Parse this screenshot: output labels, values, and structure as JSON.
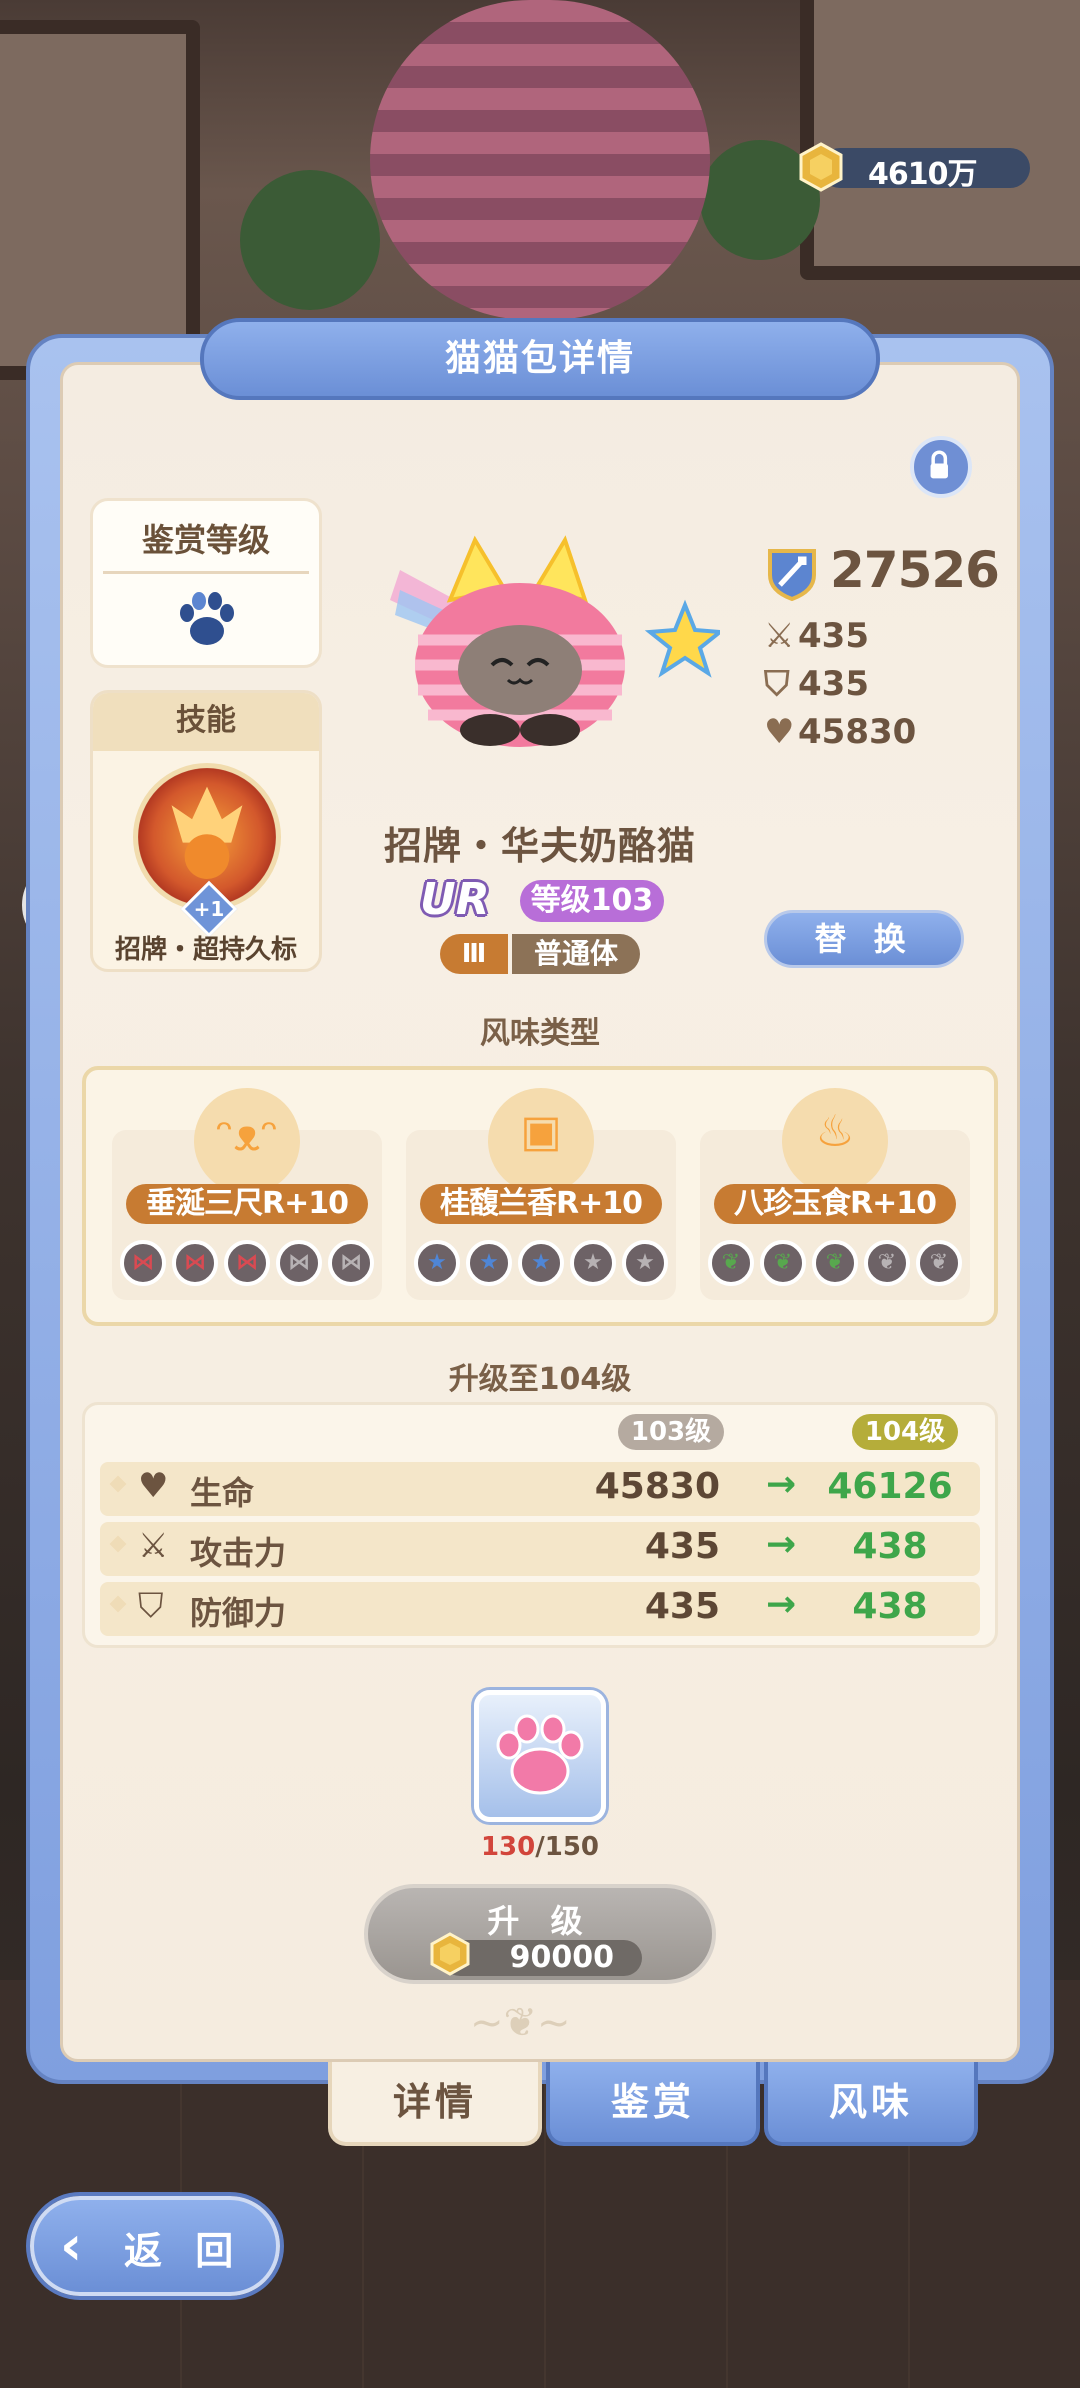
{
  "currency": {
    "amount": "4610万",
    "icon": "gold-coin-icon"
  },
  "panel_title": "猫猫包详情",
  "appraisal": {
    "title": "鉴赏等级",
    "icon": "paw-icon"
  },
  "skill": {
    "title": "技能",
    "badge": "+1",
    "name": "招牌・超持久标"
  },
  "cat": {
    "name": "招牌・华夫奶酪猫",
    "rarity": "UR",
    "level": "等级103",
    "rank": "Ⅲ",
    "body_type": "普通体"
  },
  "stats": {
    "power": "27526",
    "attack": "435",
    "defense": "435",
    "hp": "45830"
  },
  "replace_label": "替 换",
  "flavor": {
    "title": "风味类型",
    "items": [
      {
        "label": "垂涎三尺R+10",
        "icon": "cat-face-icon",
        "filled": 3,
        "total": 5,
        "color": "#d94a52",
        "glyph": "⋈"
      },
      {
        "label": "桂馥兰香R+10",
        "icon": "cube-face-icon",
        "filled": 3,
        "total": 5,
        "color": "#4f86d6",
        "glyph": "★"
      },
      {
        "label": "八珍玉食R+10",
        "icon": "flame-icon",
        "filled": 3,
        "total": 5,
        "color": "#58a84e",
        "glyph": "❦"
      }
    ]
  },
  "upgrade": {
    "title": "升级至104级",
    "current_level": "103级",
    "next_level": "104级",
    "rows": [
      {
        "label": "生命",
        "icon": "heart-icon",
        "current": "45830",
        "next": "46126"
      },
      {
        "label": "攻击力",
        "icon": "crossed-swords-icon",
        "current": "435",
        "next": "438"
      },
      {
        "label": "防御力",
        "icon": "shield-icon",
        "current": "435",
        "next": "438"
      }
    ]
  },
  "material": {
    "icon": "pink-paw-icon",
    "have": "130",
    "need": "/150"
  },
  "upgrade_button": {
    "label": "升 级",
    "cost": "90000"
  },
  "tabs": [
    "详情",
    "鉴赏",
    "风味"
  ],
  "back_label": "返 回",
  "colors": {
    "panel_blue": "#7f9fdf",
    "accent_orange": "#c77b32",
    "green_up": "#3ea64a"
  }
}
